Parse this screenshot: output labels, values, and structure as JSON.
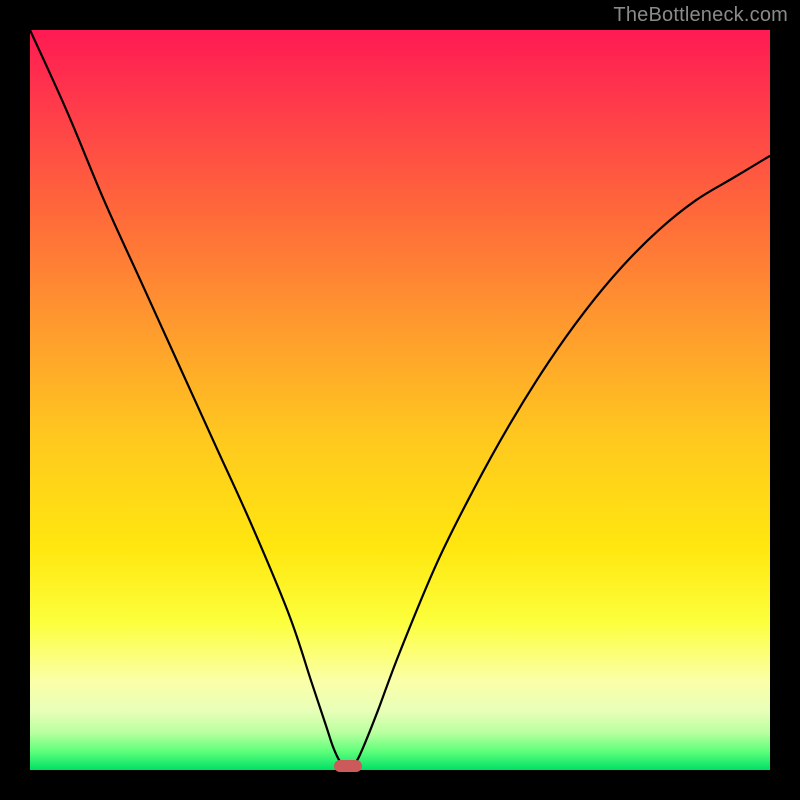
{
  "watermark": "TheBottleneck.com",
  "chart_data": {
    "type": "line",
    "title": "",
    "xlabel": "",
    "ylabel": "",
    "xlim": [
      0,
      100
    ],
    "ylim": [
      0,
      100
    ],
    "grid": false,
    "legend": false,
    "series": [
      {
        "name": "bottleneck-curve",
        "x": [
          0,
          5,
          10,
          15,
          20,
          25,
          30,
          35,
          38,
          40,
          41,
          42,
          43,
          44,
          45,
          47,
          50,
          55,
          60,
          65,
          70,
          75,
          80,
          85,
          90,
          95,
          100
        ],
        "values": [
          100,
          89,
          77,
          66,
          55,
          44,
          33,
          21,
          12,
          6,
          3,
          1,
          0.5,
          1,
          3,
          8,
          16,
          28,
          38,
          47,
          55,
          62,
          68,
          73,
          77,
          80,
          83
        ]
      }
    ],
    "optimal_marker": {
      "x": 43,
      "y": 0.5
    },
    "gradient_stops": [
      {
        "pct": 0,
        "color": "#ff1a53"
      },
      {
        "pct": 10,
        "color": "#ff3a4b"
      },
      {
        "pct": 25,
        "color": "#ff6a3a"
      },
      {
        "pct": 40,
        "color": "#ff9a2e"
      },
      {
        "pct": 55,
        "color": "#ffc81f"
      },
      {
        "pct": 70,
        "color": "#ffe70f"
      },
      {
        "pct": 80,
        "color": "#fcff3c"
      },
      {
        "pct": 88,
        "color": "#fbffa8"
      },
      {
        "pct": 92,
        "color": "#e8ffb8"
      },
      {
        "pct": 95,
        "color": "#b8ff9f"
      },
      {
        "pct": 97.5,
        "color": "#5dff7a"
      },
      {
        "pct": 100,
        "color": "#00e066"
      }
    ]
  }
}
